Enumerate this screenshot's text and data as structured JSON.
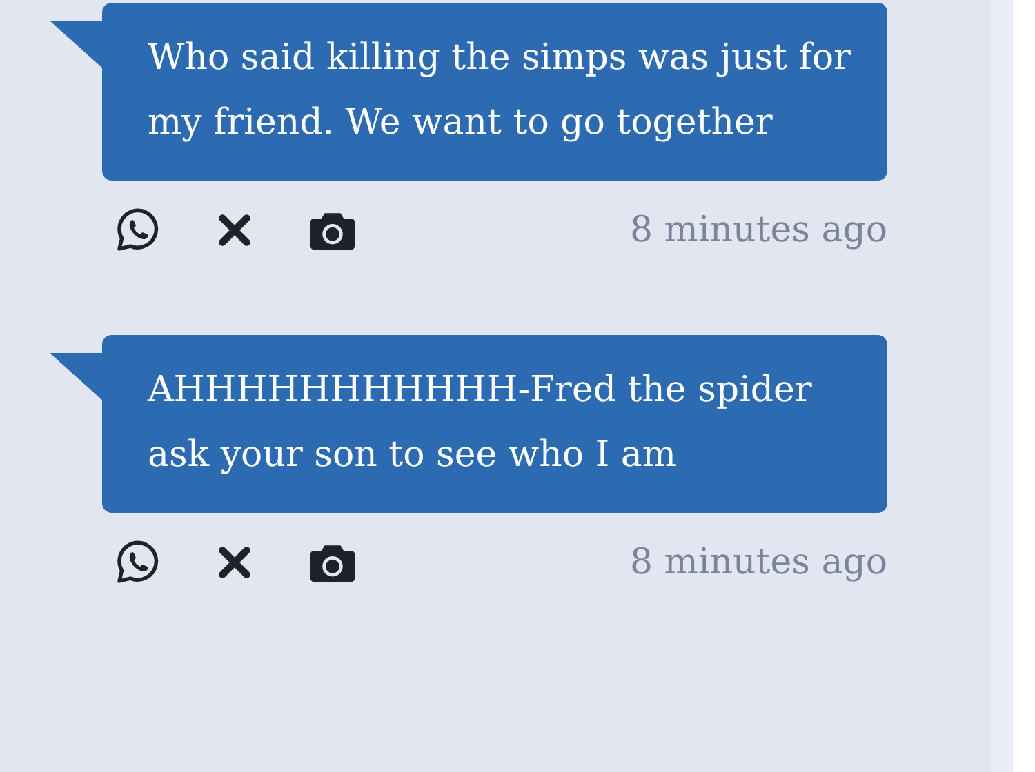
{
  "messages": [
    {
      "text": "Who said killing the simps was just for my friend. We want to go together",
      "time": "8 minutes ago"
    },
    {
      "text": "AHHHHHHHHHHH-Fred the spider ask your son to see who I am",
      "time": "8 minutes ago"
    }
  ]
}
